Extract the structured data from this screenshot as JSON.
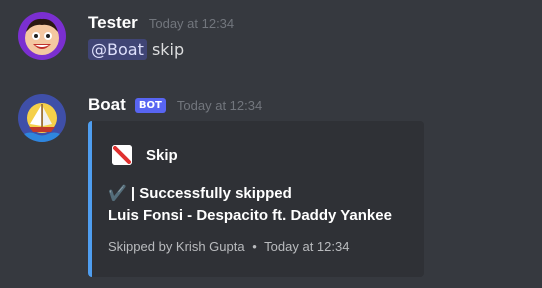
{
  "messages": [
    {
      "author": "Tester",
      "timestamp": "Today at 12:34",
      "mention": "@Boat",
      "text": "skip"
    },
    {
      "author": "Boat",
      "bot_tag": "BOT",
      "timestamp": "Today at 12:34",
      "embed": {
        "accent_color": "#4f9ef0",
        "author_name": "Skip",
        "description_line1": "✔️ | Successfully skipped",
        "description_line2": "Luis Fonsi - Despacito ft. Daddy Yankee",
        "footer_text": "Skipped by Krish Gupta",
        "footer_separator": "•",
        "footer_timestamp": "Today at 12:34"
      }
    }
  ]
}
